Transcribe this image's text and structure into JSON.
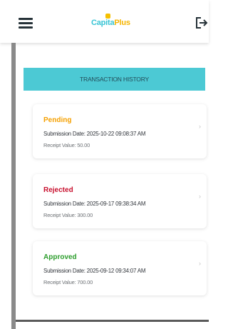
{
  "header": {
    "brand_part1": "Capita",
    "brand_part2": "Plus",
    "menu_icon": "hamburger-menu-icon",
    "logout_icon": "logout-icon",
    "brand_colors": {
      "primary": "#38c4d4",
      "secondary": "#f5b400"
    }
  },
  "page": {
    "title": "TRANSACTION HISTORY",
    "banner_color": "#4cc9d4"
  },
  "transactions": [
    {
      "status": "Pending",
      "status_color": "#f5a000",
      "submission": "Submission Date: 2025-10-22 09:08:37 AM",
      "receipt": "Receipt Value: 50.00"
    },
    {
      "status": "Rejected",
      "status_color": "#c8102e",
      "submission": "Submission Date: 2025-09-17 09:38:34 AM",
      "receipt": "Receipt Value: 300.00"
    },
    {
      "status": "Approved",
      "status_color": "#2e9e2e",
      "submission": "Submission Date: 2025-09-12 09:34:07 AM",
      "receipt": "Receipt Value: 700.00"
    }
  ]
}
